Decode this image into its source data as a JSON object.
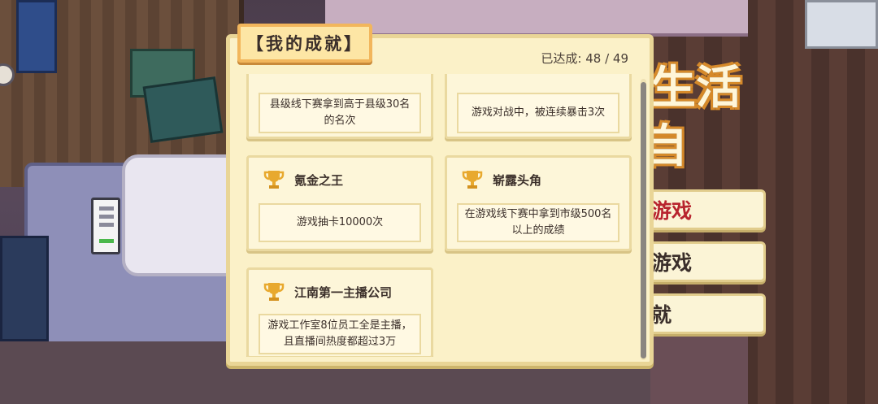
{
  "panel": {
    "title": "【我的成就】",
    "achieved_label": "已达成:",
    "achieved_count": "48",
    "achieved_total": "49",
    "scroll_position": 0.5
  },
  "achievements": [
    {
      "name": "",
      "description": "县级线下赛拿到高于县级30名的名次",
      "icon": "trophy-icon"
    },
    {
      "name": "",
      "description": "游戏对战中，被连续暴击3次",
      "icon": "trophy-icon"
    },
    {
      "name": "氪金之王",
      "description": "游戏抽卡10000次",
      "icon": "trophy-icon"
    },
    {
      "name": "崭露头角",
      "description": "在游戏线下赛中拿到市级500名以上的成绩",
      "icon": "trophy-icon"
    },
    {
      "name": "江南第一主播公司",
      "description": "游戏工作室8位员工全是主播，且直播间热度都超过3万",
      "icon": "trophy-icon"
    }
  ],
  "background": {
    "title_line1": "生活",
    "title_line2": "自"
  },
  "menu": {
    "item1": "游戏",
    "item2": "游戏",
    "item3": "就"
  },
  "colors": {
    "panel_bg": "#fbf1c8",
    "title_tab_border": "#f2b65c",
    "menu_highlight": "#b8242e",
    "trophy": "#e8a92e"
  }
}
